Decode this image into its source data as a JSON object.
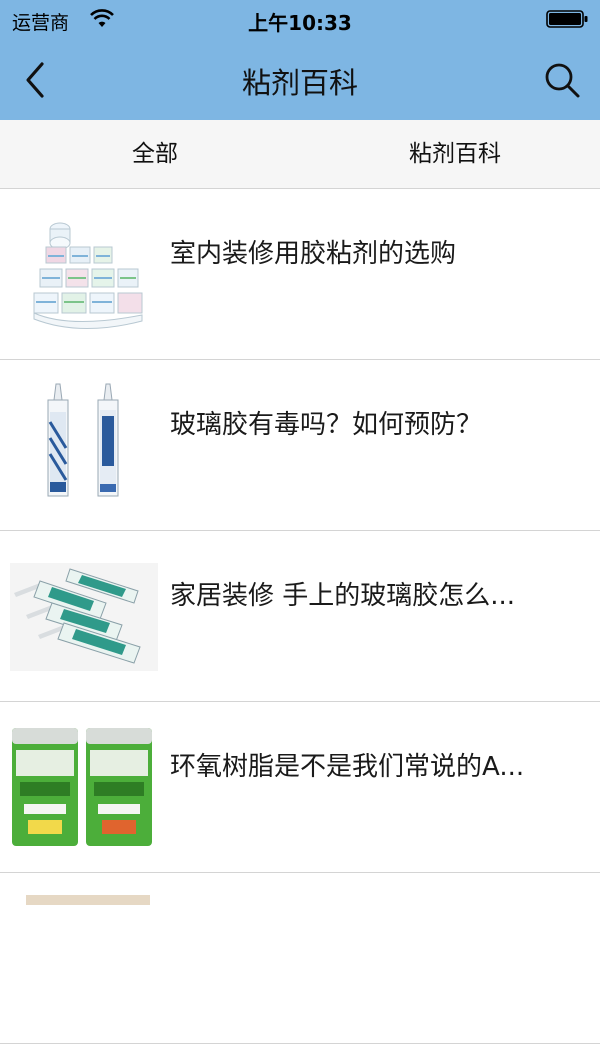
{
  "status_bar": {
    "carrier": "运营商",
    "time": "上午10:33"
  },
  "nav": {
    "title": "粘剂百科",
    "back_icon": "chevron-left-icon",
    "search_icon": "search-icon"
  },
  "tabs": [
    {
      "label": "全部"
    },
    {
      "label": "粘剂百科"
    }
  ],
  "list": [
    {
      "title": "室内装修用胶粘剂的选购",
      "thumb": "label-rolls-image"
    },
    {
      "title": "玻璃胶有毒吗？如何预防？",
      "thumb": "sealant-tubes-image"
    },
    {
      "title": "家居装修 手上的玻璃胶怎么...",
      "thumb": "caulk-cartridges-image"
    },
    {
      "title": "环氧树脂是不是我们常说的A...",
      "thumb": "epoxy-cans-image"
    }
  ],
  "colors": {
    "header_bg": "#7eb6e3",
    "tab_bg": "#f6f6f6",
    "divider": "#d4d4d4"
  }
}
